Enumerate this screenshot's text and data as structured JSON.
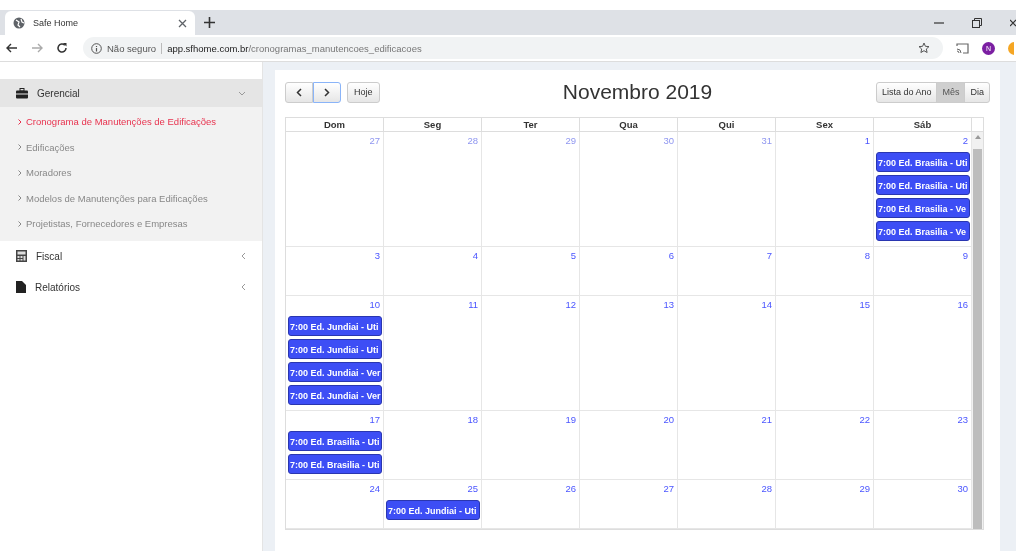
{
  "browser": {
    "tab_title": "Safe Home",
    "security": "Não seguro",
    "url_host": "app.sfhome.com.br",
    "url_path": "/cronogramas_manutencoes_edificacoes",
    "avatar": "N"
  },
  "sidebar": {
    "sections": [
      {
        "label": "Gerencial",
        "expanded": true,
        "children": [
          {
            "label": "Cronograma de Manutenções de Edificações",
            "selected": true
          },
          {
            "label": "Edificações",
            "selected": false
          },
          {
            "label": "Moradores",
            "selected": false
          },
          {
            "label": "Modelos de Manutenções para Edificações",
            "selected": false
          },
          {
            "label": "Projetistas, Fornecedores e Empresas",
            "selected": false
          }
        ]
      },
      {
        "label": "Fiscal",
        "expanded": false
      },
      {
        "label": "Relatórios",
        "expanded": false
      }
    ]
  },
  "calendar": {
    "today_button": "Hoje",
    "title": "Novembro 2019",
    "views": [
      {
        "label": "Lista do Ano",
        "selected": false
      },
      {
        "label": "Mês",
        "selected": true
      },
      {
        "label": "Dia",
        "selected": false
      }
    ],
    "weekdays": [
      "Dom",
      "Seg",
      "Ter",
      "Qua",
      "Qui",
      "Sex",
      "Sáb"
    ],
    "weeks": [
      {
        "days": [
          {
            "number": "27",
            "other_month": true
          },
          {
            "number": "28",
            "other_month": true
          },
          {
            "number": "29",
            "other_month": true
          },
          {
            "number": "30",
            "other_month": true
          },
          {
            "number": "31",
            "other_month": true
          },
          {
            "number": "1",
            "other_month": false
          },
          {
            "number": "2",
            "other_month": false,
            "events": [
              "7:00 Ed. Brasilia - Uti",
              "7:00 Ed. Brasilia - Uti",
              "7:00 Ed. Brasilia - Ve",
              "7:00 Ed. Brasilia - Ve"
            ]
          }
        ]
      },
      {
        "days": [
          {
            "number": "3",
            "other_month": false
          },
          {
            "number": "4",
            "other_month": false
          },
          {
            "number": "5",
            "other_month": false
          },
          {
            "number": "6",
            "other_month": false
          },
          {
            "number": "7",
            "other_month": false
          },
          {
            "number": "8",
            "other_month": false
          },
          {
            "number": "9",
            "other_month": false
          }
        ]
      },
      {
        "days": [
          {
            "number": "10",
            "other_month": false,
            "events": [
              "7:00 Ed. Jundiai - Uti",
              "7:00 Ed. Jundiai - Uti",
              "7:00 Ed. Jundiai - Ver",
              "7:00 Ed. Jundiai - Ver"
            ]
          },
          {
            "number": "11",
            "other_month": false
          },
          {
            "number": "12",
            "other_month": false
          },
          {
            "number": "13",
            "other_month": false
          },
          {
            "number": "14",
            "other_month": false
          },
          {
            "number": "15",
            "other_month": false
          },
          {
            "number": "16",
            "other_month": false
          }
        ]
      },
      {
        "days": [
          {
            "number": "17",
            "other_month": false,
            "events": [
              "7:00 Ed. Brasilia - Uti",
              "7:00 Ed. Brasilia - Uti"
            ]
          },
          {
            "number": "18",
            "other_month": false
          },
          {
            "number": "19",
            "other_month": false
          },
          {
            "number": "20",
            "other_month": false
          },
          {
            "number": "21",
            "other_month": false
          },
          {
            "number": "22",
            "other_month": false
          },
          {
            "number": "23",
            "other_month": false
          }
        ]
      },
      {
        "days": [
          {
            "number": "24",
            "other_month": false
          },
          {
            "number": "25",
            "other_month": false,
            "events": [
              "7:00 Ed. Jundiai - Uti"
            ]
          },
          {
            "number": "26",
            "other_month": false
          },
          {
            "number": "27",
            "other_month": false
          },
          {
            "number": "28",
            "other_month": false
          },
          {
            "number": "29",
            "other_month": false
          },
          {
            "number": "30",
            "other_month": false
          }
        ]
      }
    ]
  }
}
